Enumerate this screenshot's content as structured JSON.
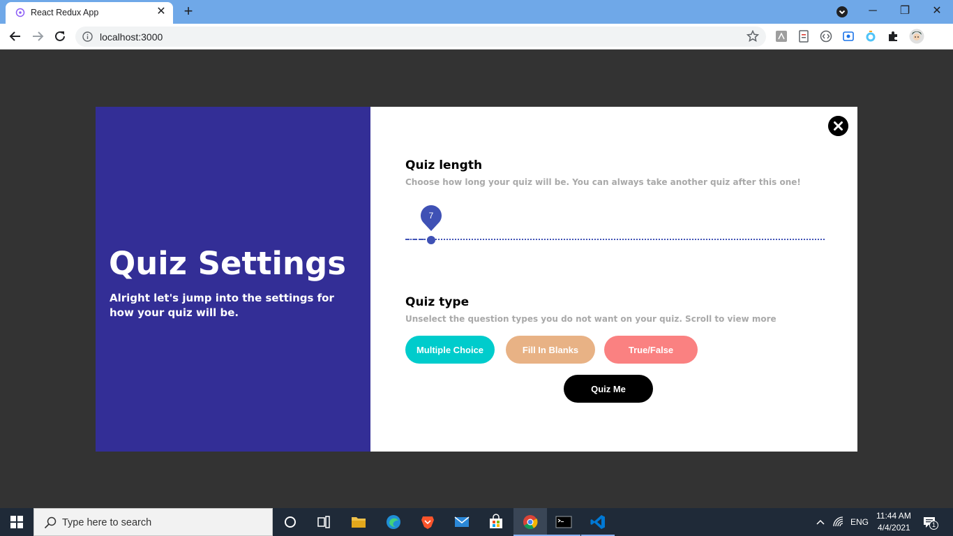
{
  "browser": {
    "tab_title": "React Redux App",
    "tab_close_glyph": "✕",
    "new_tab_glyph": "+",
    "url": "localhost:3000",
    "window_controls": {
      "minimize": "─",
      "maximize": "❐",
      "close": "✕"
    }
  },
  "modal": {
    "heading": "Quiz Settings",
    "description": "Alright let's jump into the settings for how your quiz will be.",
    "quiz_length": {
      "title": "Quiz length",
      "subtitle": "Choose how long your quiz will be. You can always take another quiz after this one!",
      "slider_value": "7",
      "slider_fraction": 0.06
    },
    "quiz_type": {
      "title": "Quiz type",
      "subtitle": "Unselect the question types you do not want on your quiz. Scroll to view more",
      "options": [
        {
          "label": "Multiple Choice",
          "color": "#00cccc"
        },
        {
          "label": "Fill In Blanks",
          "color": "#e8b285"
        },
        {
          "label": "True/False",
          "color": "#fa8181"
        }
      ]
    },
    "submit_label": "Quiz Me",
    "colors": {
      "left_panel": "#332e96",
      "slider": "#3f51b5"
    }
  },
  "taskbar": {
    "search_placeholder": "Type here to search",
    "language": "ENG",
    "time": "11:44 AM",
    "date": "4/4/2021",
    "notification_count": "1"
  }
}
